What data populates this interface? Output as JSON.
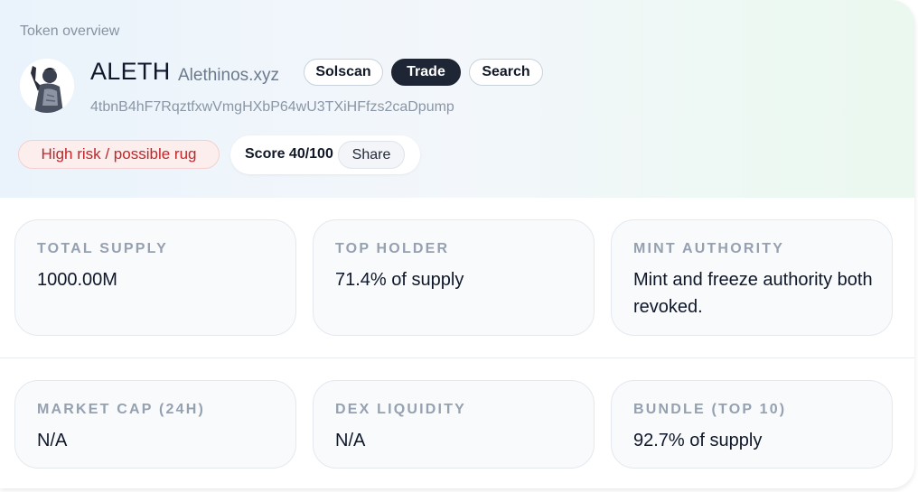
{
  "header": {
    "label": "Token overview",
    "symbol": "ALETH",
    "domain": "Alethinos.xyz",
    "address": "4tbnB4hF7RqztfxwVmgHXbP64wU3TXiHFfzs2caDpump",
    "buttons": {
      "solscan": "Solscan",
      "trade": "Trade",
      "search": "Search"
    },
    "risk_badge": "High risk / possible rug",
    "score": "Score 40/100",
    "share": "Share"
  },
  "stats": [
    {
      "label": "TOTAL SUPPLY",
      "value": "1000.00M"
    },
    {
      "label": "TOP HOLDER",
      "value": "71.4% of supply"
    },
    {
      "label": "MINT AUTHORITY",
      "value": "Mint and freeze authority both revoked."
    },
    {
      "label": "MARKET CAP (24H)",
      "value": "N/A"
    },
    {
      "label": "DEX LIQUIDITY",
      "value": "N/A"
    },
    {
      "label": "BUNDLE (TOP 10)",
      "value": "92.7% of supply"
    }
  ],
  "colors": {
    "risk_red": "#c0262a",
    "trade_dark": "#1e2535",
    "label_gray": "#95a1b0"
  },
  "icons": {
    "avatar": "statue-avatar-icon"
  }
}
